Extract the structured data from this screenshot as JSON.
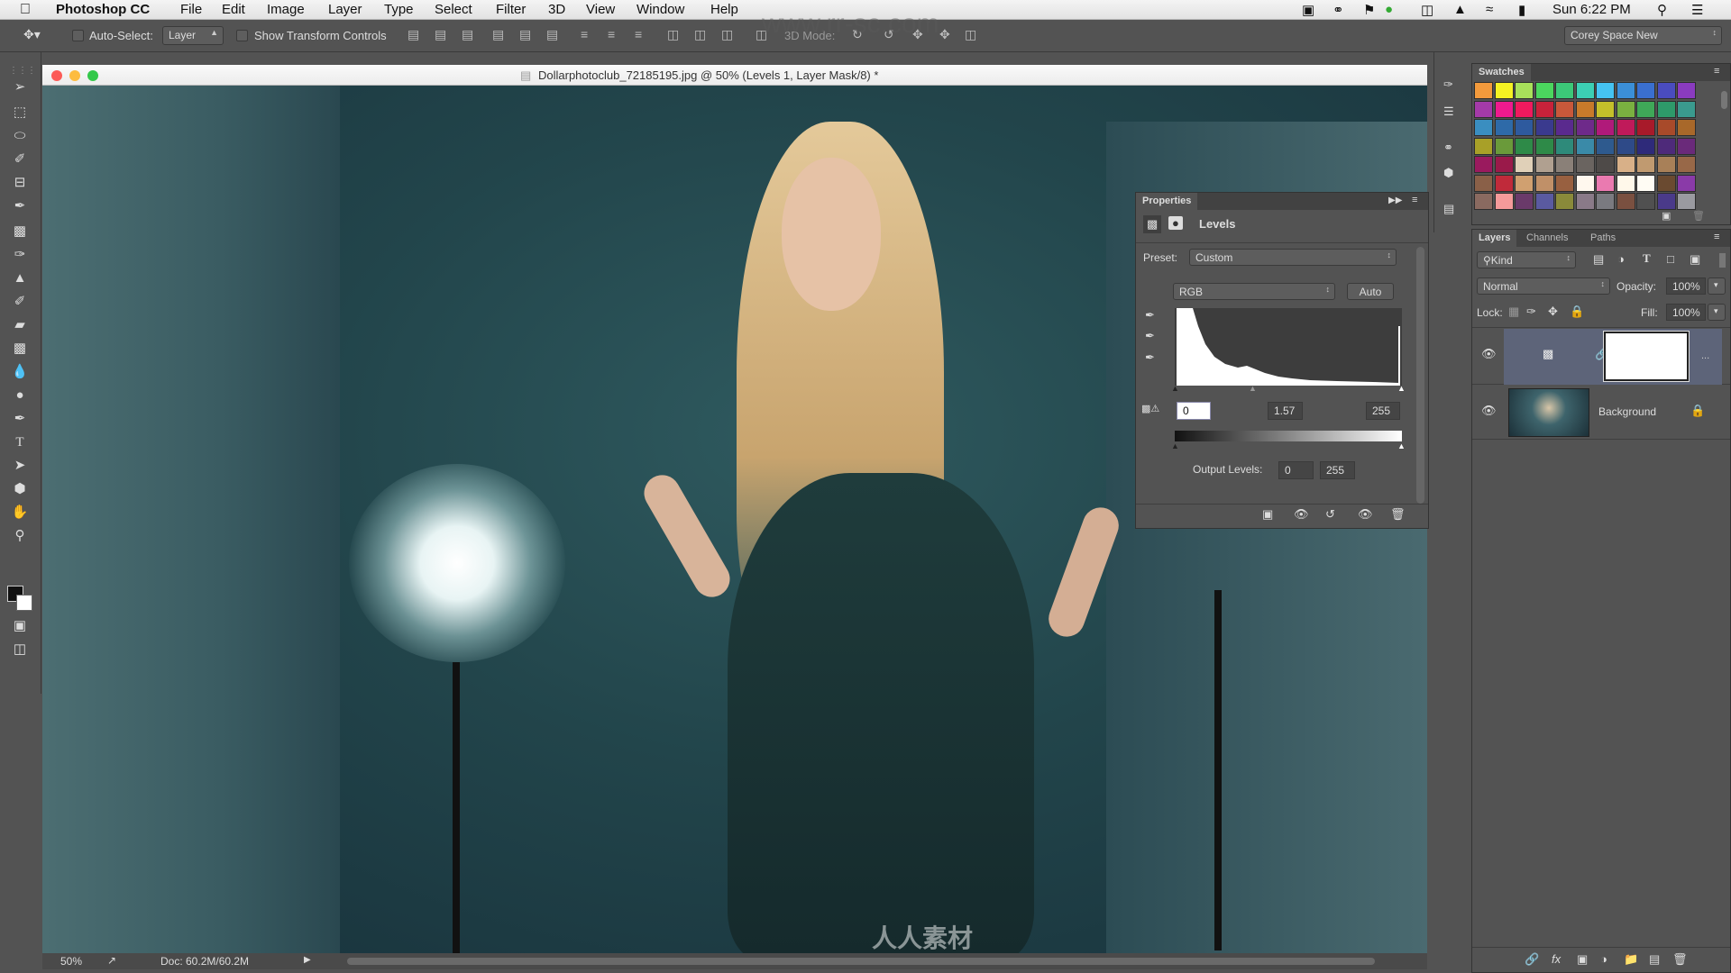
{
  "menubar": {
    "apple": "",
    "app": "Photoshop CC",
    "items": [
      "File",
      "Edit",
      "Image",
      "Layer",
      "Type",
      "Select",
      "Filter",
      "3D",
      "View",
      "Window",
      "Help"
    ],
    "clock": "Sun 6:22 PM",
    "status_icons": [
      "video-icon",
      "creative-cloud-icon",
      "notification-icon",
      "sync-icon",
      "display-icon",
      "airplay-icon",
      "wifi-icon",
      "battery-icon"
    ]
  },
  "options": {
    "auto_select_label": "Auto-Select:",
    "auto_select_value": "Layer",
    "show_transform_label": "Show Transform Controls",
    "mode3d_label": "3D Mode:",
    "workspace": "Corey Space New"
  },
  "document": {
    "title": "Dollarphotoclub_72185195.jpg @ 50% (Levels 1, Layer Mask/8) *",
    "zoom": "50%",
    "doc_size": "Doc: 60.2M/60.2M"
  },
  "watermark": {
    "url": "www.rr-sc.com",
    "brand": "人人素材"
  },
  "properties": {
    "tab": "Properties",
    "title": "Levels",
    "preset_label": "Preset:",
    "preset_value": "Custom",
    "channel": "RGB",
    "auto_label": "Auto",
    "input_black": "0",
    "input_gamma": "1.57",
    "input_white": "255",
    "output_label": "Output Levels:",
    "output_black": "0",
    "output_white": "255"
  },
  "swatches": {
    "tab": "Swatches",
    "colors": [
      [
        "#f39a3c",
        "#f5f222",
        "#a8e05a",
        "#4bd65e",
        "#3cc878",
        "#3ccfb4",
        "#45c3f2",
        "#3b8fd8",
        "#3a6fcf",
        "#4a4cbf",
        "#8a3bbf"
      ],
      [
        "#a43aa8",
        "#ee1a8e",
        "#ef1a5e",
        "#c8223a",
        "#c8583a",
        "#c87a2a",
        "#c4c02a",
        "#7ab040",
        "#3fa858",
        "#2e9a6a",
        "#3a9a8e"
      ],
      [
        "#3a8ec0",
        "#2e6aa8",
        "#2e5a9e",
        "#3a3a8e",
        "#5a2a8e",
        "#6e2a8a",
        "#b01a7a",
        "#c01a5a",
        "#a81a2a",
        "#a84a2a",
        "#a8682a"
      ],
      [
        "#a8a028",
        "#6a9a3a",
        "#2e8a48",
        "#2e8a48",
        "#2e8a7a",
        "#3a8aa8",
        "#2e5a8e",
        "#2e4a88",
        "#2e2a7a",
        "#4e2a7a",
        "#6a2a7a"
      ],
      [
        "#9a1a5e",
        "#9a1a4a",
        "#e0d0b8",
        "#b0a090",
        "#8a8078",
        "#6a6460",
        "#4e4a48",
        "#d8b088",
        "#c09a70",
        "#a88058",
        "#986848"
      ],
      [
        "#8a6048",
        "#c02a3a",
        "#d0a070",
        "#c09068",
        "#986040",
        "#fff8ee",
        "#ea7ab0",
        "#fff8ea",
        "#fffcf4",
        "#6a4a30",
        "#8a3aa8"
      ],
      [
        "#8a6a60",
        "#f59a9a",
        "#6a3a6a",
        "#5a5aa0",
        "#8a8a3a",
        "#8a7a88",
        "#7a7a80",
        "#7a5040",
        "#505050",
        "#4a3a8a",
        "#9a9aa0"
      ]
    ]
  },
  "layers": {
    "tabs": [
      "Layers",
      "Channels",
      "Paths"
    ],
    "filter": "Kind",
    "blend_mode": "Normal",
    "opacity_label": "Opacity:",
    "opacity": "100%",
    "lock_label": "Lock:",
    "fill_label": "Fill:",
    "fill": "100%",
    "items": [
      {
        "name": "",
        "type": "levels-adjustment",
        "selected": true
      },
      {
        "name": "Background",
        "type": "image",
        "locked": true
      }
    ]
  }
}
